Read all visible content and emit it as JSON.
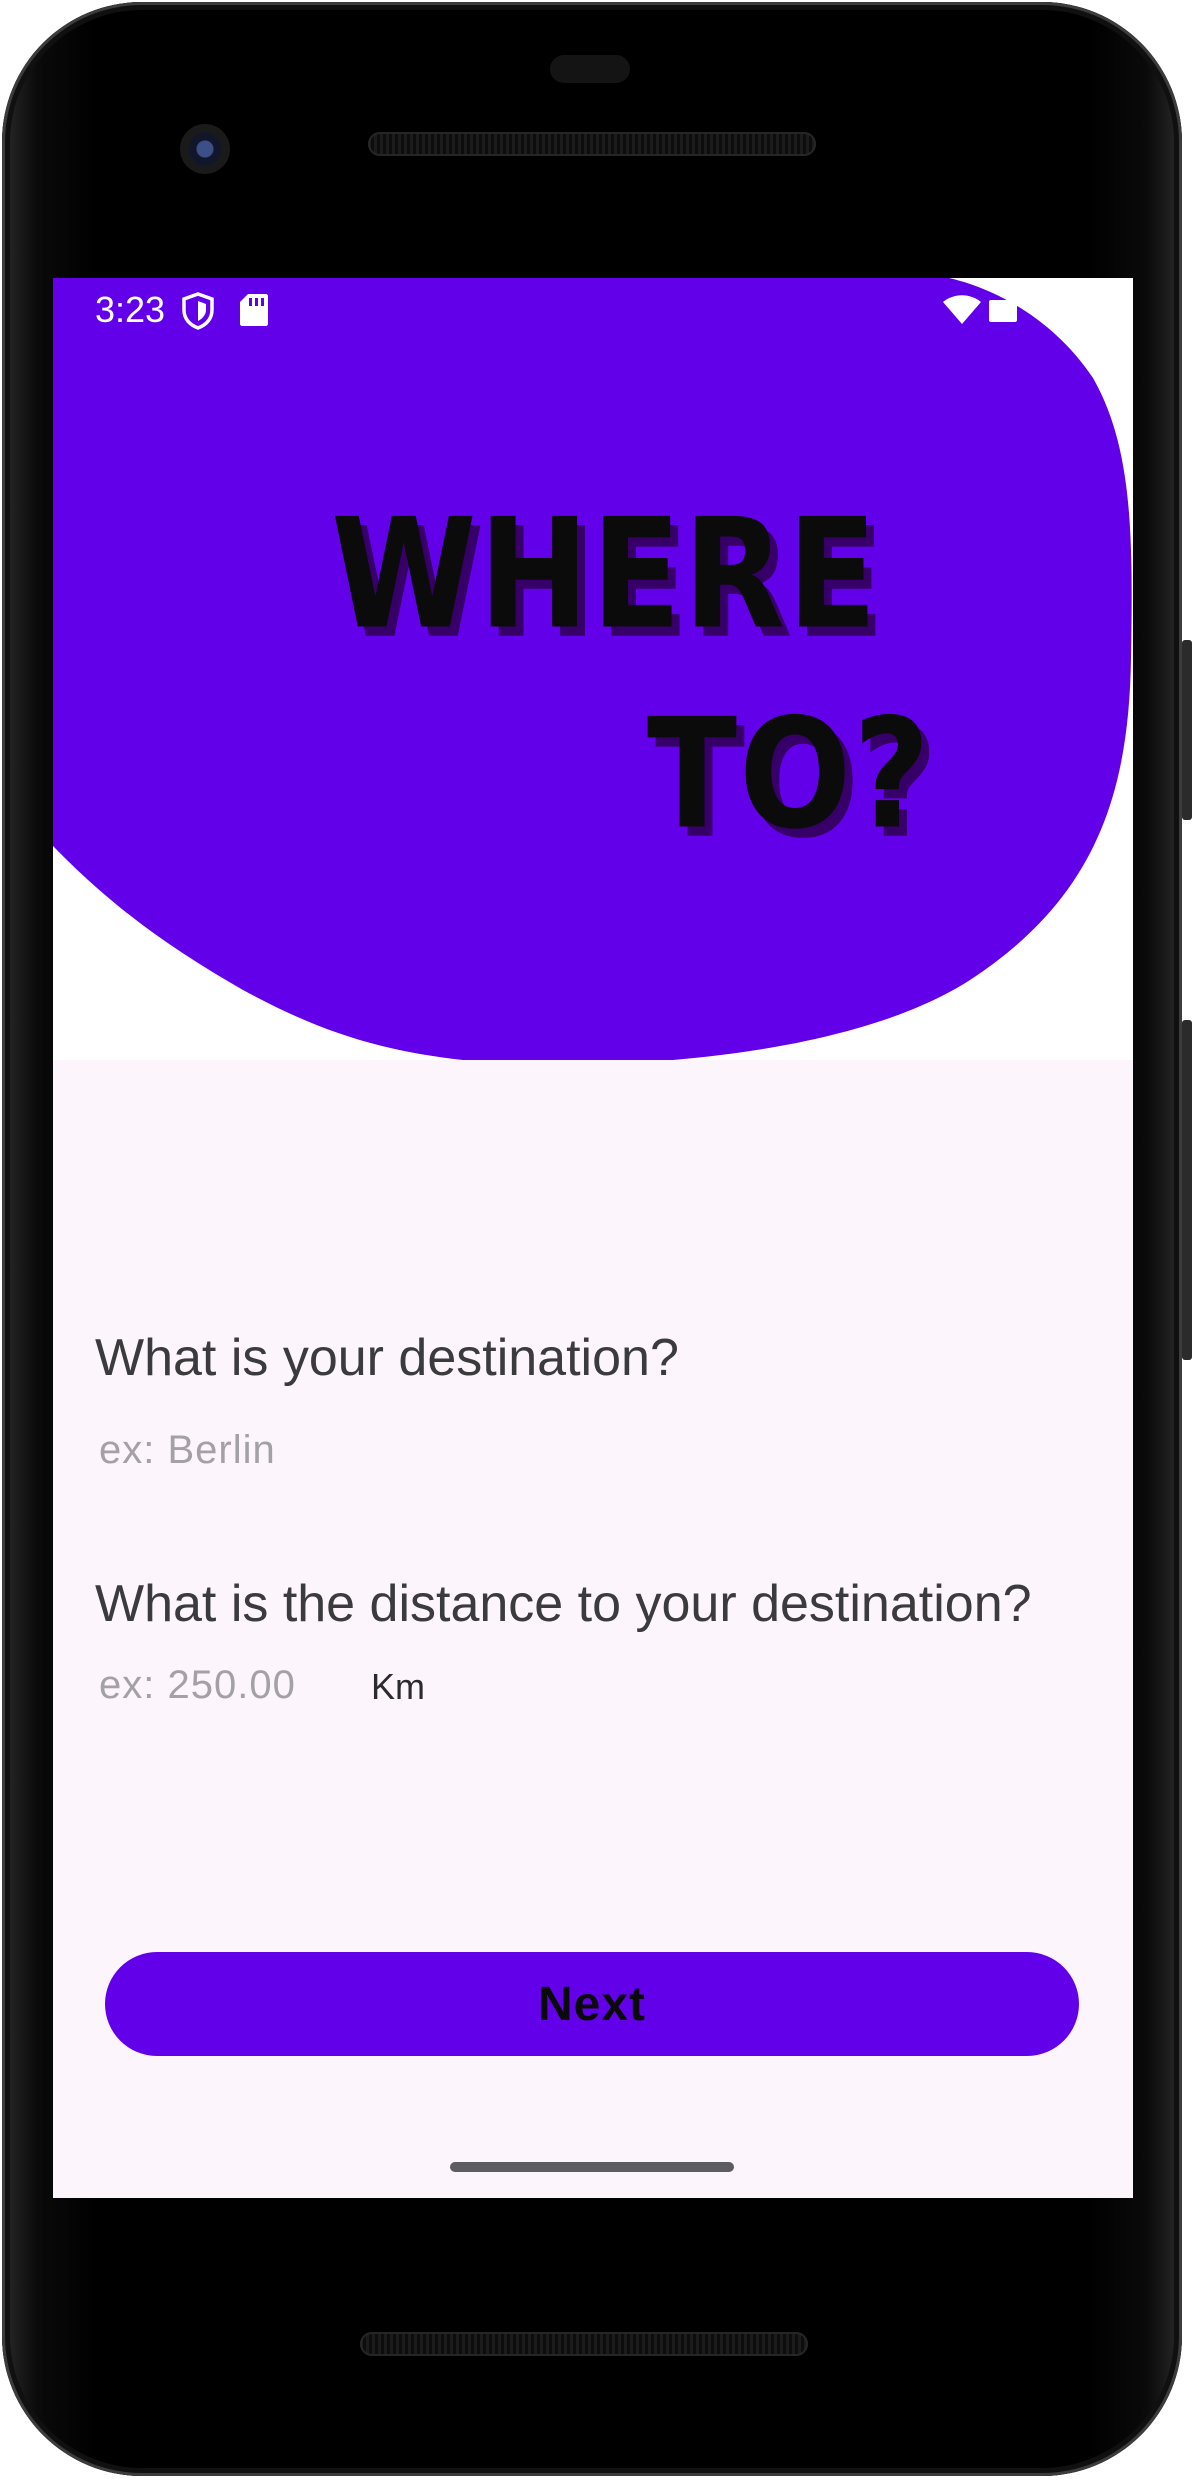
{
  "status_bar": {
    "time": "3:23",
    "icons": [
      "shield-icon",
      "sd-card-icon",
      "wifi-icon",
      "battery-icon"
    ]
  },
  "hero": {
    "headline_line1": "WHERE",
    "headline_line2": "TO?",
    "blob_color": "#6200ea"
  },
  "form": {
    "destination_question": "What is your destination?",
    "destination_placeholder": "ex: Berlin",
    "destination_value": "",
    "distance_question": "What is the distance to your destination?",
    "distance_placeholder": "ex: 250.00",
    "distance_value": "",
    "distance_unit": "Km"
  },
  "actions": {
    "next_label": "Next"
  },
  "colors": {
    "accent": "#6200ea",
    "screen_background": "#fdf5fc",
    "question_text": "#3b3a3d",
    "placeholder_text": "#a3a1a5"
  }
}
